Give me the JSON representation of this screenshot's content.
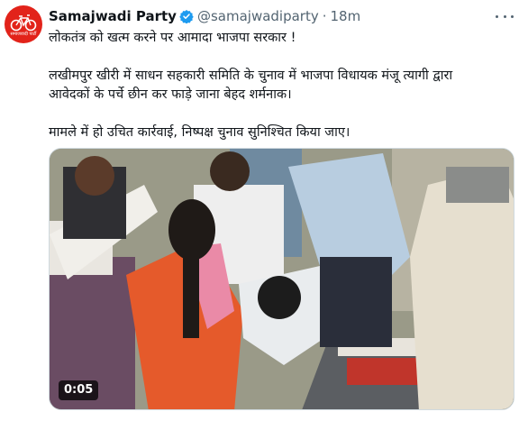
{
  "author": {
    "display_name": "Samajwadi Party",
    "handle": "@samajwadiparty",
    "separator": "·",
    "time": "18m",
    "avatar_text": "समाजवादी पार्टी",
    "verified": true
  },
  "tweet": {
    "lines": [
      "लोकतंत्र को खत्म करने पर आमादा भाजपा सरकार !",
      "लखीमपुर खीरी में साधन सहकारी समिति के चुनाव में भाजपा विधायक मंजू त्यागी द्वारा",
      "आवेदकों के पर्चे छीन कर फाड़े जाना बेहद शर्मनाक।",
      "मामले में हो उचित कार्रवाई, निष्पक्ष चुनाव सुनिश्चित किया जाए।"
    ]
  },
  "media": {
    "type": "video",
    "duration": "0:05"
  },
  "colors": {
    "text": "#0f1419",
    "secondary": "#536471",
    "verified": "#1d9bf0",
    "avatar_bg": "#e2231a"
  }
}
